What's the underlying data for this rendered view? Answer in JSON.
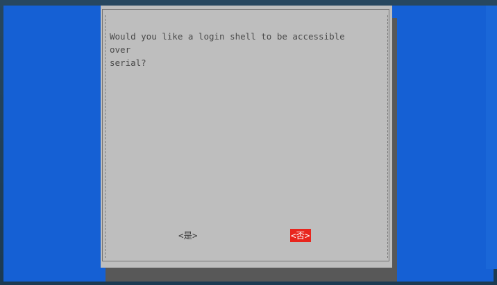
{
  "dialog": {
    "message": "Would you like a login shell to be accessible over\nserial?",
    "yes_label": "<是>",
    "no_label": "<否>"
  },
  "colors": {
    "terminal_bg": "#1560d4",
    "dialog_bg": "#bebebe",
    "selected_button_bg": "#e8261e"
  }
}
